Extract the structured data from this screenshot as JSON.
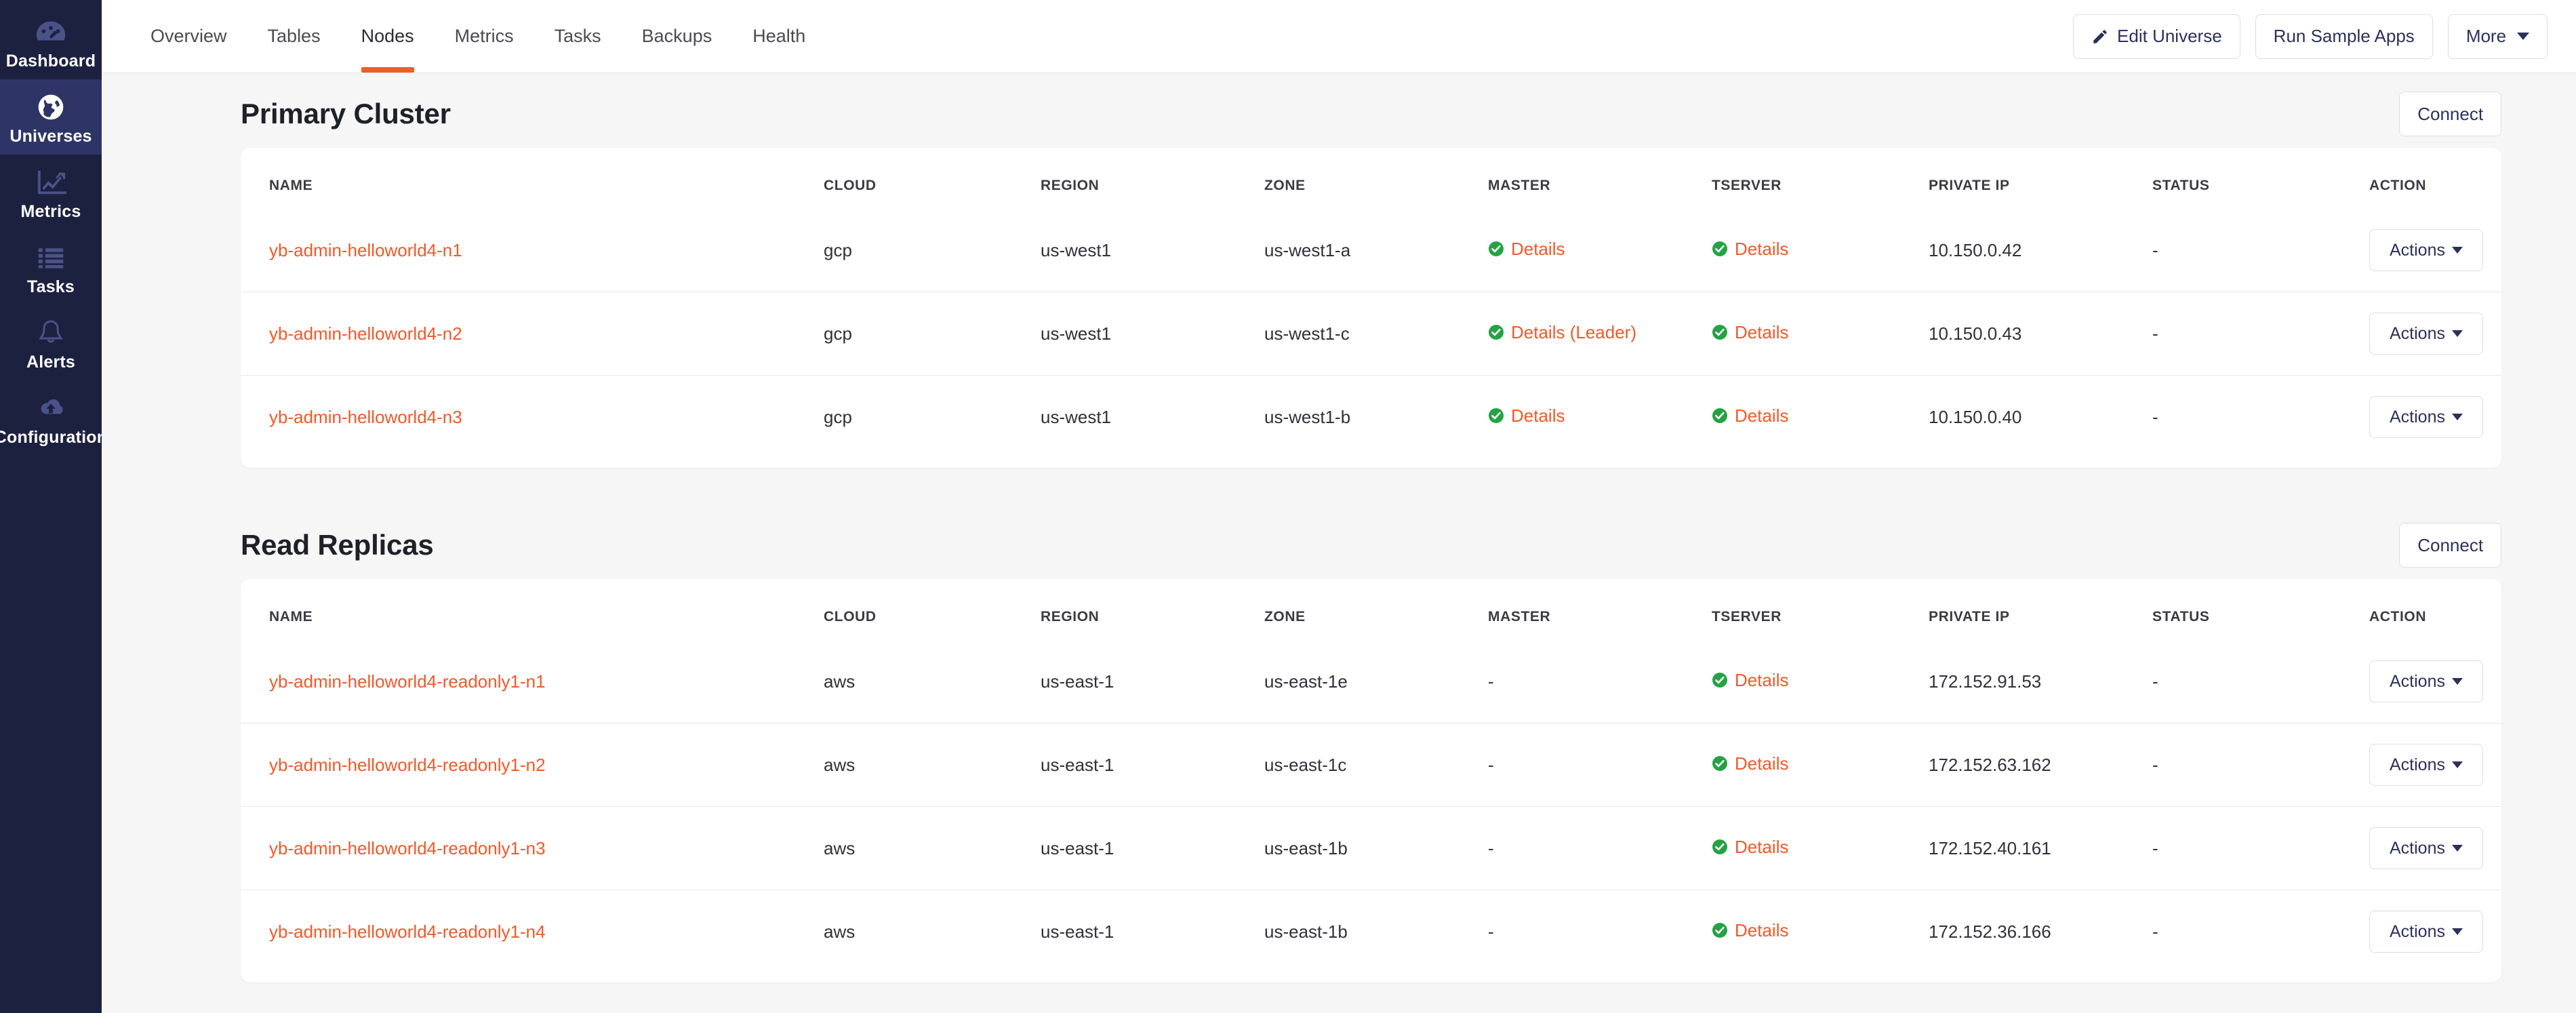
{
  "sidebar": {
    "items": [
      {
        "label": "Dashboard",
        "icon": "dashboard-icon",
        "active": false
      },
      {
        "label": "Universes",
        "icon": "globe-icon",
        "active": true
      },
      {
        "label": "Metrics",
        "icon": "chart-line-icon",
        "active": false
      },
      {
        "label": "Tasks",
        "icon": "list-icon",
        "active": false
      },
      {
        "label": "Alerts",
        "icon": "bell-icon",
        "active": false
      },
      {
        "label": "Configuration",
        "icon": "cloud-upload-icon",
        "active": false
      }
    ]
  },
  "topbar": {
    "tabs": [
      {
        "label": "Overview",
        "active": false
      },
      {
        "label": "Tables",
        "active": false
      },
      {
        "label": "Nodes",
        "active": true
      },
      {
        "label": "Metrics",
        "active": false
      },
      {
        "label": "Tasks",
        "active": false
      },
      {
        "label": "Backups",
        "active": false
      },
      {
        "label": "Health",
        "active": false
      }
    ],
    "edit_universe_label": "Edit Universe",
    "run_sample_apps_label": "Run Sample Apps",
    "more_label": "More",
    "accent_color": "#eb5f27"
  },
  "columns": [
    "NAME",
    "CLOUD",
    "REGION",
    "ZONE",
    "MASTER",
    "TSERVER",
    "PRIVATE IP",
    "STATUS",
    "ACTION"
  ],
  "action_button_label": "Actions",
  "connect_label": "Connect",
  "sections": [
    {
      "title": "Primary Cluster",
      "connect_label": "Connect",
      "rows": [
        {
          "name": "yb-admin-helloworld4-n1",
          "cloud": "gcp",
          "region": "us-west1",
          "zone": "us-west1-a",
          "master": {
            "status": "ok",
            "label": "Details"
          },
          "tserver": {
            "status": "ok",
            "label": "Details"
          },
          "private_ip": "10.150.0.42",
          "status": "-",
          "action": "Actions"
        },
        {
          "name": "yb-admin-helloworld4-n2",
          "cloud": "gcp",
          "region": "us-west1",
          "zone": "us-west1-c",
          "master": {
            "status": "ok",
            "label": "Details (Leader)"
          },
          "tserver": {
            "status": "ok",
            "label": "Details"
          },
          "private_ip": "10.150.0.43",
          "status": "-",
          "action": "Actions"
        },
        {
          "name": "yb-admin-helloworld4-n3",
          "cloud": "gcp",
          "region": "us-west1",
          "zone": "us-west1-b",
          "master": {
            "status": "ok",
            "label": "Details"
          },
          "tserver": {
            "status": "ok",
            "label": "Details"
          },
          "private_ip": "10.150.0.40",
          "status": "-",
          "action": "Actions"
        }
      ]
    },
    {
      "title": "Read Replicas",
      "connect_label": "Connect",
      "rows": [
        {
          "name": "yb-admin-helloworld4-readonly1-n1",
          "cloud": "aws",
          "region": "us-east-1",
          "zone": "us-east-1e",
          "master": {
            "status": "none",
            "label": "-"
          },
          "tserver": {
            "status": "ok",
            "label": "Details"
          },
          "private_ip": "172.152.91.53",
          "status": "-",
          "action": "Actions"
        },
        {
          "name": "yb-admin-helloworld4-readonly1-n2",
          "cloud": "aws",
          "region": "us-east-1",
          "zone": "us-east-1c",
          "master": {
            "status": "none",
            "label": "-"
          },
          "tserver": {
            "status": "ok",
            "label": "Details"
          },
          "private_ip": "172.152.63.162",
          "status": "-",
          "action": "Actions"
        },
        {
          "name": "yb-admin-helloworld4-readonly1-n3",
          "cloud": "aws",
          "region": "us-east-1",
          "zone": "us-east-1b",
          "master": {
            "status": "none",
            "label": "-"
          },
          "tserver": {
            "status": "ok",
            "label": "Details"
          },
          "private_ip": "172.152.40.161",
          "status": "-",
          "action": "Actions"
        },
        {
          "name": "yb-admin-helloworld4-readonly1-n4",
          "cloud": "aws",
          "region": "us-east-1",
          "zone": "us-east-1b",
          "master": {
            "status": "none",
            "label": "-"
          },
          "tserver": {
            "status": "ok",
            "label": "Details"
          },
          "private_ip": "172.152.36.166",
          "status": "-",
          "action": "Actions"
        }
      ]
    }
  ],
  "colors": {
    "link": "#ef5a2b",
    "ok": "#25a244",
    "sidebar_bg": "#1d2140",
    "sidebar_active": "#2e3566",
    "page_bg": "#f6f6f7"
  }
}
